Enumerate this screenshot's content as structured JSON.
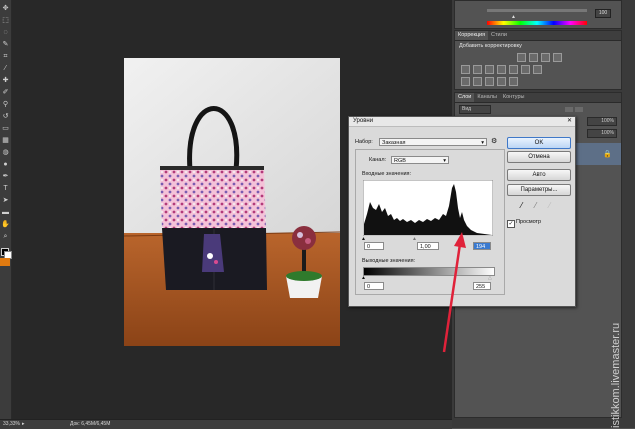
{
  "statusbar": {
    "zoom": "33,33%",
    "doc_size": "Док: 6,45M/6,45M"
  },
  "color_panel": {
    "value_box": "100"
  },
  "adjustments_panel": {
    "tabs": [
      "Коррекция",
      "Стили"
    ],
    "subtitle": "Добавить корректировку"
  },
  "layers_panel": {
    "tabs": [
      "Слои",
      "Каналы",
      "Контуры"
    ],
    "kind_filter": "Вид",
    "percent_1": "100%",
    "percent_2": "100%"
  },
  "levels_dialog": {
    "title": "Уровни",
    "preset_label": "Набор:",
    "preset_value": "Заказная",
    "channel_label": "Канал:",
    "channel_value": "RGB",
    "input_label": "Входные значения:",
    "input_black": "0",
    "input_gray": "1,00",
    "input_white": "194",
    "output_label": "Выходные значения:",
    "output_black": "0",
    "output_white": "255",
    "buttons": {
      "ok": "OK",
      "cancel": "Отмена",
      "auto": "Авто",
      "options": "Параметры..."
    },
    "preview_label": "Просмотр",
    "preview_checked": true
  },
  "watermark": "istikkom.livemaster.ru",
  "colors": {
    "dialog_bg": "#dadada",
    "arrow": "#e0223a",
    "accent": "#3f78c8"
  }
}
